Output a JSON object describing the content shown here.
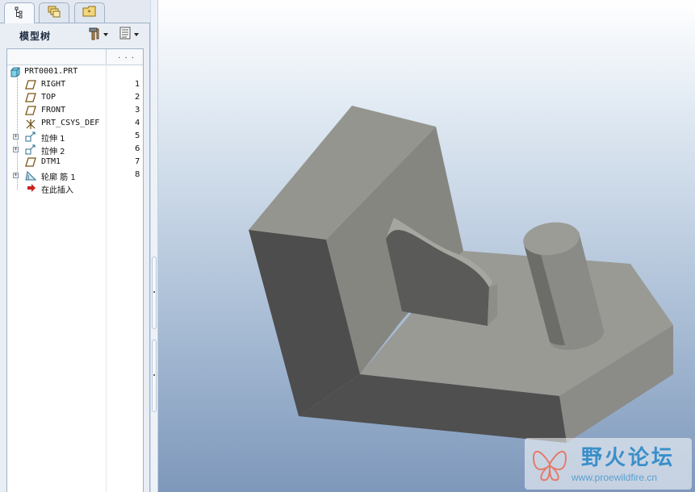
{
  "tabs": [
    {
      "name": "model-tree-tab",
      "icon": "tree-icon",
      "active": true
    },
    {
      "name": "layers-tab",
      "icon": "layers-icon",
      "active": false
    },
    {
      "name": "favorites-tab",
      "icon": "star-folder-icon",
      "active": false
    }
  ],
  "panel": {
    "title": "模型树",
    "hammer_icon": "settings-hammer-icon",
    "list_icon": "show-options-icon",
    "column_header": ". . ."
  },
  "tree": {
    "root": {
      "label": "PRT0001.PRT",
      "icon": "part-icon"
    },
    "items": [
      {
        "label": "RIGHT",
        "num": "1",
        "icon": "datum-plane-icon",
        "expandable": false
      },
      {
        "label": "TOP",
        "num": "2",
        "icon": "datum-plane-icon",
        "expandable": false
      },
      {
        "label": "FRONT",
        "num": "3",
        "icon": "datum-plane-icon",
        "expandable": false
      },
      {
        "label": "PRT_CSYS_DEF",
        "num": "4",
        "icon": "csys-icon",
        "expandable": false
      },
      {
        "label": "拉伸 1",
        "num": "5",
        "icon": "extrude-icon",
        "expandable": true
      },
      {
        "label": "拉伸 2",
        "num": "6",
        "icon": "extrude-icon",
        "expandable": true
      },
      {
        "label": "DTM1",
        "num": "7",
        "icon": "datum-plane-icon",
        "expandable": false
      },
      {
        "label": "轮廓 筋 1",
        "num": "8",
        "icon": "rib-icon",
        "expandable": true
      },
      {
        "label": "在此插入",
        "num": "",
        "icon": "insert-here-arrow-icon",
        "expandable": false
      }
    ]
  },
  "watermark": {
    "title": "野火论坛",
    "url": "www.proewildfire.cn",
    "logo_icon": "butterfly-logo"
  },
  "colors": {
    "viewport_top": "#ffffff",
    "viewport_bottom": "#7e98bb",
    "model_gray": "#8f8f8a",
    "insert_arrow": "#c8221e"
  }
}
